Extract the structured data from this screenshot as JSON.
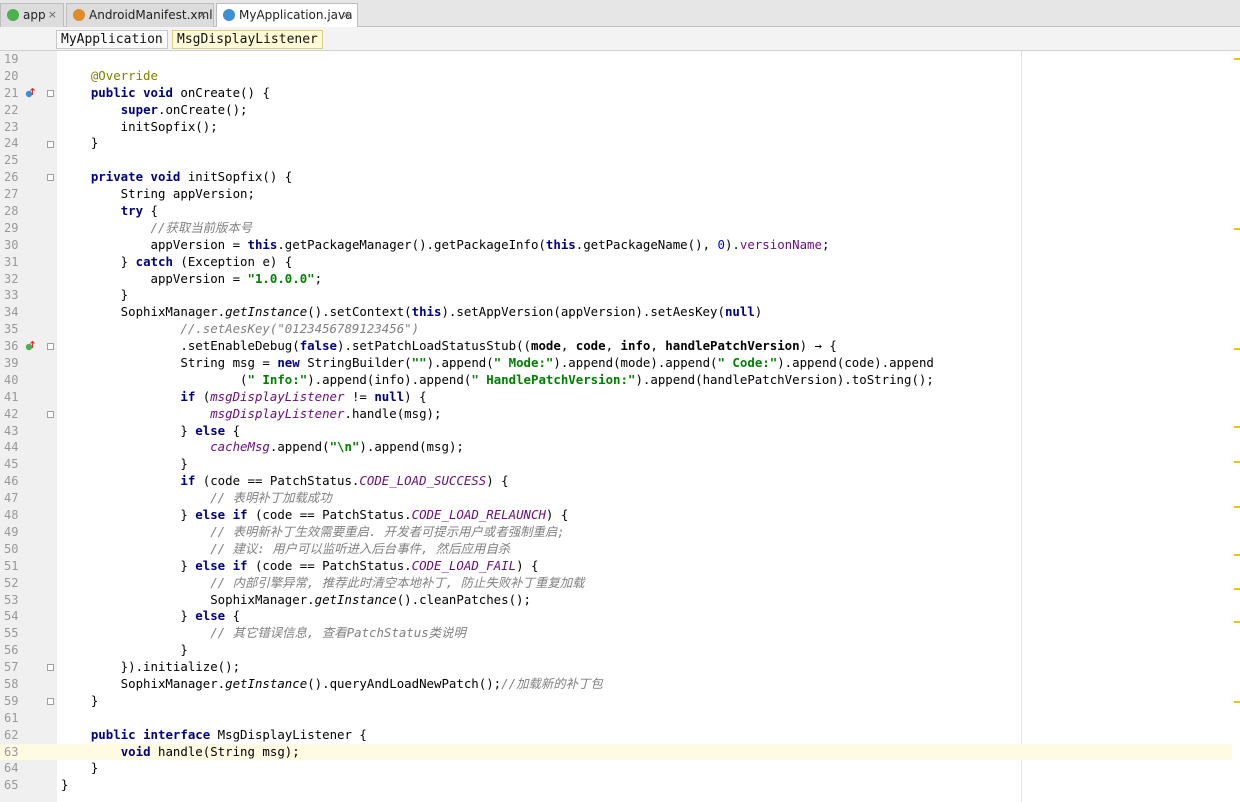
{
  "tabs": [
    {
      "label": "app",
      "icon": "android-module-icon",
      "color": "#4caf50",
      "active": false
    },
    {
      "label": "AndroidManifest.xml",
      "icon": "manifest-file-icon",
      "color": "#e08b2a",
      "active": false
    },
    {
      "label": "MyApplication.java",
      "icon": "java-class-icon",
      "color": "#3d8fd6",
      "active": true
    }
  ],
  "close_glyph": "×",
  "breadcrumbs": [
    {
      "label": "MyApplication"
    },
    {
      "label": "MsgDisplayListener"
    }
  ],
  "editor": {
    "current_line": 63,
    "lines": [
      {
        "n": "19",
        "t": ""
      },
      {
        "n": "20",
        "t": "    @Override"
      },
      {
        "n": "21",
        "t": "    public void onCreate() {"
      },
      {
        "n": "22",
        "t": "        super.onCreate();"
      },
      {
        "n": "23",
        "t": "        initSopfix();"
      },
      {
        "n": "24",
        "t": "    }"
      },
      {
        "n": "25",
        "t": ""
      },
      {
        "n": "26",
        "t": "    private void initSopfix() {"
      },
      {
        "n": "27",
        "t": "        String appVersion;"
      },
      {
        "n": "28",
        "t": "        try {"
      },
      {
        "n": "29",
        "t": "            //获取当前版本号"
      },
      {
        "n": "30",
        "t": "            appVersion = this.getPackageManager().getPackageInfo(this.getPackageName(), 0).versionName;"
      },
      {
        "n": "31",
        "t": "        } catch (Exception e) {"
      },
      {
        "n": "32",
        "t": "            appVersion = \"1.0.0.0\";"
      },
      {
        "n": "33",
        "t": "        }"
      },
      {
        "n": "34",
        "t": "        SophixManager.getInstance().setContext(this).setAppVersion(appVersion).setAesKey(null)"
      },
      {
        "n": "35",
        "t": "                //.setAesKey(\"0123456789123456\")"
      },
      {
        "n": "36",
        "t": "                .setEnableDebug(false).setPatchLoadStatusStub((mode, code, info, handlePatchVersion) → {"
      },
      {
        "n": "39",
        "t": "                String msg = new StringBuilder(\"\").append(\" Mode:\").append(mode).append(\" Code:\").append(code).append"
      },
      {
        "n": "40",
        "t": "                        (\" Info:\").append(info).append(\" HandlePatchVersion:\").append(handlePatchVersion).toString();"
      },
      {
        "n": "41",
        "t": "                if (msgDisplayListener != null) {"
      },
      {
        "n": "42",
        "t": "                    msgDisplayListener.handle(msg);"
      },
      {
        "n": "43",
        "t": "                } else {"
      },
      {
        "n": "44",
        "t": "                    cacheMsg.append(\"\\n\").append(msg);"
      },
      {
        "n": "45",
        "t": "                }"
      },
      {
        "n": "46",
        "t": "                if (code == PatchStatus.CODE_LOAD_SUCCESS) {"
      },
      {
        "n": "47",
        "t": "                    // 表明补丁加载成功"
      },
      {
        "n": "48",
        "t": "                } else if (code == PatchStatus.CODE_LOAD_RELAUNCH) {"
      },
      {
        "n": "49",
        "t": "                    // 表明新补丁生效需要重启. 开发者可提示用户或者强制重启;"
      },
      {
        "n": "50",
        "t": "                    // 建议: 用户可以监听进入后台事件, 然后应用自杀"
      },
      {
        "n": "51",
        "t": "                } else if (code == PatchStatus.CODE_LOAD_FAIL) {"
      },
      {
        "n": "52",
        "t": "                    // 内部引擎异常, 推荐此时清空本地补丁, 防止失败补丁重复加载"
      },
      {
        "n": "53",
        "t": "                    SophixManager.getInstance().cleanPatches();"
      },
      {
        "n": "54",
        "t": "                } else {"
      },
      {
        "n": "55",
        "t": "                    // 其它错误信息, 查看PatchStatus类说明"
      },
      {
        "n": "56",
        "t": "                }"
      },
      {
        "n": "57",
        "t": "        }).initialize();"
      },
      {
        "n": "58",
        "t": "        SophixManager.getInstance().queryAndLoadNewPatch();//加载新的补丁包"
      },
      {
        "n": "59",
        "t": "    }"
      },
      {
        "n": "61",
        "t": ""
      },
      {
        "n": "62",
        "t": "    public interface MsgDisplayListener {"
      },
      {
        "n": "63",
        "t": "        void handle(String msg);"
      },
      {
        "n": "64",
        "t": "    }"
      },
      {
        "n": "65",
        "t": "}"
      }
    ]
  },
  "gutter_icons": [
    {
      "line": "21",
      "name": "override-method-icon"
    },
    {
      "line": "36",
      "name": "implement-method-icon"
    }
  ],
  "fold_markers": [
    "21",
    "24",
    "26",
    "36",
    "42",
    "57",
    "59",
    "63"
  ],
  "error_stripe_color": "#e6c800",
  "colors": {
    "keyword": "#000080",
    "string": "#008000",
    "comment": "#808080",
    "field": "#660e7a",
    "number": "#0000ff",
    "annotation": "#808000"
  }
}
